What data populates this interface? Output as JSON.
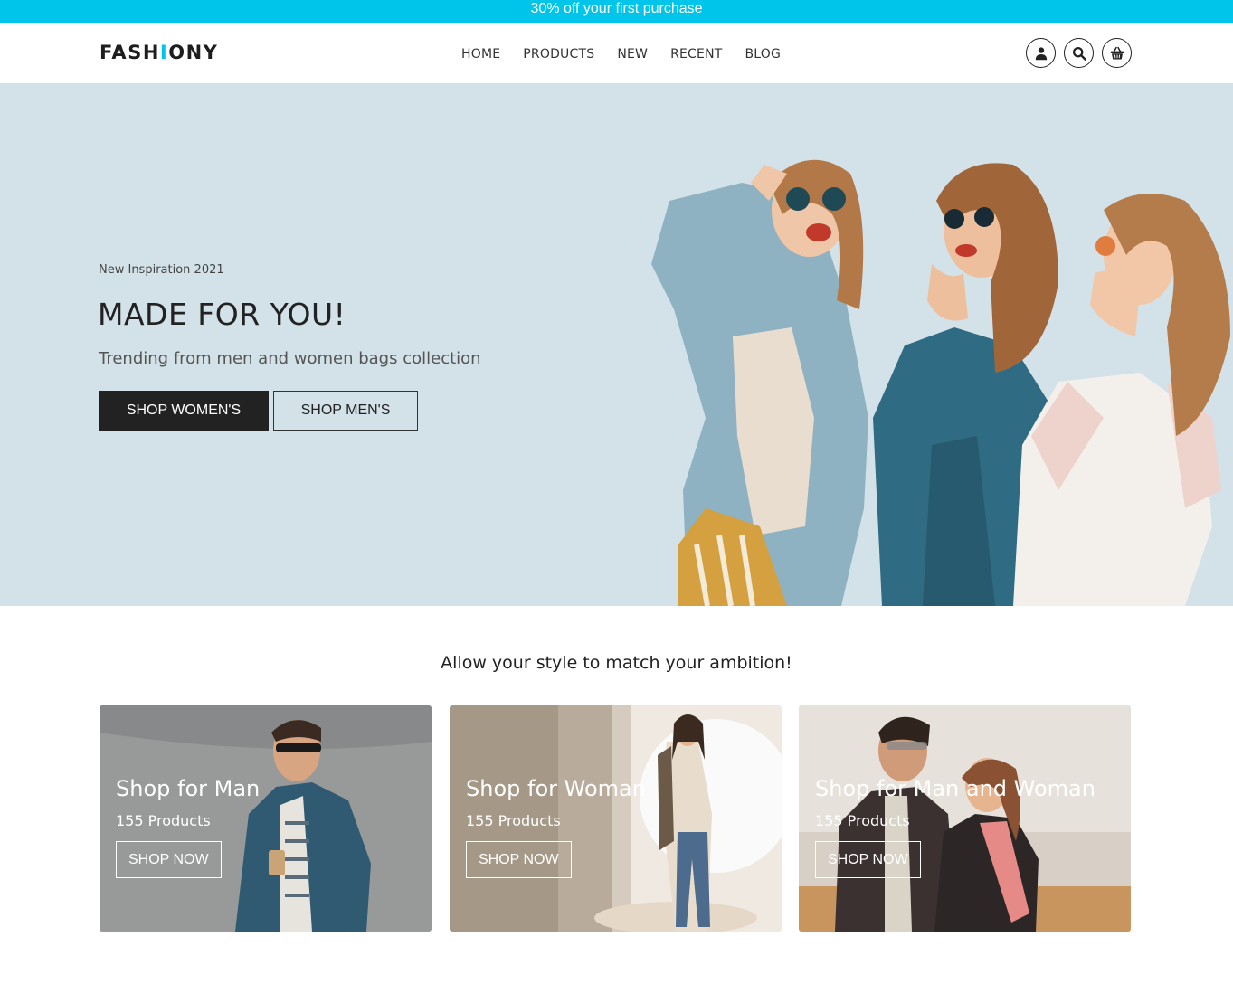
{
  "promo": {
    "text": "30% off your first purchase"
  },
  "header": {
    "logo_prefix": "FASH",
    "logo_accent": "I",
    "logo_suffix": "ONY",
    "nav": [
      "HOME",
      "PRODUCTS",
      "NEW",
      "RECENT",
      "BLOG"
    ],
    "icons": [
      "user-icon",
      "search-icon",
      "basket-icon"
    ]
  },
  "hero": {
    "kicker": "New Inspiration 2021",
    "title": "MADE FOR YOU!",
    "subtitle": "Trending from men and women bags collection",
    "btn_women": "SHOP WOMEN'S",
    "btn_men": "SHOP MEN'S"
  },
  "tagline": "Allow your style to match your ambition!",
  "cards": [
    {
      "title": "Shop for Man",
      "count": "155 Products",
      "button": "SHOP NOW"
    },
    {
      "title": "Shop for Woman",
      "count": "155 Products",
      "button": "SHOP NOW"
    },
    {
      "title": "Shop for Man and Woman",
      "count": "155 Products",
      "button": "SHOP NOW"
    }
  ],
  "colors": {
    "accent": "#00c5ea",
    "hero_bg": "#d3e1e8",
    "dark": "#222222"
  }
}
